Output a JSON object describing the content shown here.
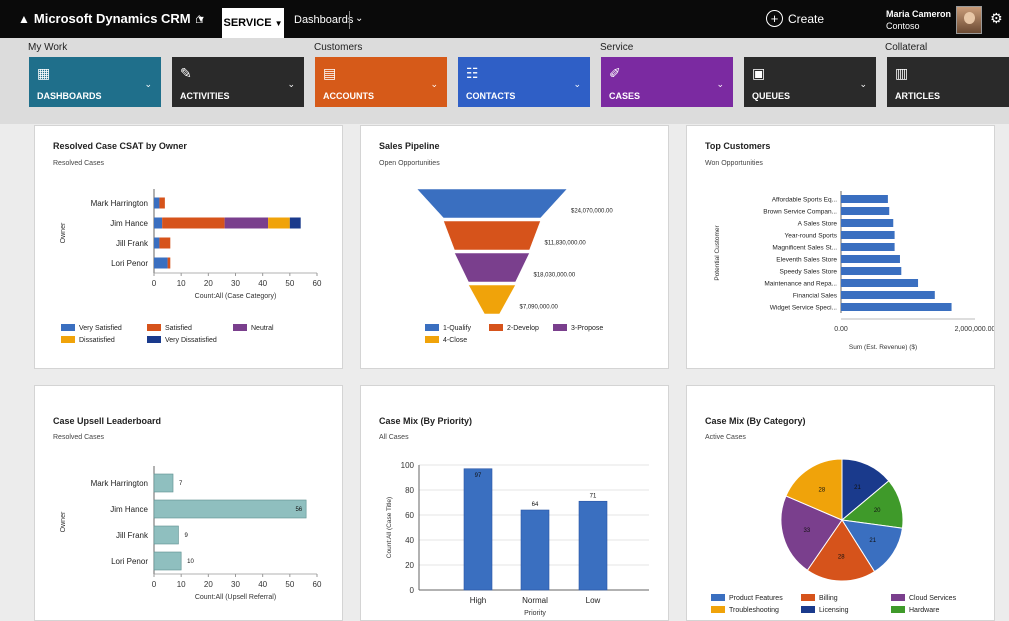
{
  "topbar": {
    "brand": "Microsoft Dynamics CRM",
    "area": "SERVICE",
    "nav": "Dashboards",
    "create": "Create",
    "user_name": "Maria Cameron",
    "user_org": "Contoso"
  },
  "nav_groups": [
    "My Work",
    "Customers",
    "Service",
    "Collateral"
  ],
  "tiles": [
    {
      "label": "DASHBOARDS",
      "icon": "dashboard-icon",
      "color": "#1f6f8b"
    },
    {
      "label": "ACTIVITIES",
      "icon": "activities-icon",
      "color": "#2a2a2a"
    },
    {
      "label": "ACCOUNTS",
      "icon": "accounts-icon",
      "color": "#d65a19"
    },
    {
      "label": "CONTACTS",
      "icon": "contacts-icon",
      "color": "#2f5fc6"
    },
    {
      "label": "CASES",
      "icon": "cases-icon",
      "color": "#7b2aa1"
    },
    {
      "label": "QUEUES",
      "icon": "queues-icon",
      "color": "#2a2a2a"
    },
    {
      "label": "ARTICLES",
      "icon": "articles-icon",
      "color": "#2a2a2a"
    }
  ],
  "cards": {
    "csat": {
      "title": "Resolved Case CSAT by Owner",
      "subtitle": "Resolved Cases"
    },
    "pipeline": {
      "title": "Sales Pipeline",
      "subtitle": "Open Opportunities"
    },
    "customers": {
      "title": "Top Customers",
      "subtitle": "Won Opportunities"
    },
    "upsell": {
      "title": "Case Upsell Leaderboard",
      "subtitle": "Resolved Cases"
    },
    "priority": {
      "title": "Case Mix (By Priority)",
      "subtitle": "All Cases"
    },
    "category": {
      "title": "Case Mix (By Category)",
      "subtitle": "Active Cases"
    }
  },
  "chart_data": [
    {
      "id": "csat",
      "type": "bar",
      "orientation": "horizontal",
      "stacked": true,
      "categories": [
        "Mark Harrington",
        "Jim Hance",
        "Jill Frank",
        "Lori Penor"
      ],
      "series": [
        {
          "name": "Very Satisfied",
          "color": "#3a6fc0",
          "values": [
            2,
            3,
            2,
            5
          ]
        },
        {
          "name": "Satisfied",
          "color": "#d6531b",
          "values": [
            2,
            23,
            4,
            1
          ]
        },
        {
          "name": "Neutral",
          "color": "#7a3f8d",
          "values": [
            0,
            16,
            0,
            0
          ]
        },
        {
          "name": "Dissatisfied",
          "color": "#f0a30a",
          "values": [
            0,
            8,
            0,
            0
          ]
        },
        {
          "name": "Very Dissatisfied",
          "color": "#1a3a8c",
          "values": [
            0,
            4,
            0,
            0
          ]
        }
      ],
      "xlabel": "Count:All (Case Category)",
      "ylabel": "Owner",
      "xlim": [
        0,
        60
      ],
      "xticks": [
        "0",
        "10",
        "20",
        "30",
        "40",
        "50",
        "60"
      ],
      "legend": "bottom"
    },
    {
      "id": "pipeline",
      "type": "funnel",
      "categories": [
        "1-Qualify",
        "2-Develop",
        "3-Propose",
        "4-Close"
      ],
      "values": [
        24070000,
        11830000,
        18030000,
        7090000
      ],
      "labels": [
        "$24,070,000.00",
        "$11,830,000.00",
        "$18,030,000.00",
        "$7,090,000.00"
      ],
      "colors": [
        "#3a6fc0",
        "#d6531b",
        "#7a3f8d",
        "#f0a30a"
      ],
      "legend": "bottom"
    },
    {
      "id": "customers",
      "type": "bar",
      "orientation": "horizontal",
      "categories": [
        "Affordable Sports Eq...",
        "Brown Service Compan...",
        "A Sales Store",
        "Year-round Sports",
        "Magnificent Sales St...",
        "Eleventh Sales Store",
        "Speedy Sales Store",
        "Maintenance and Repa...",
        "Financial Sales",
        "Widget Service Speci..."
      ],
      "values": [
        700000,
        720000,
        780000,
        800000,
        800000,
        880000,
        900000,
        1150000,
        1400000,
        1650000
      ],
      "xlabel": "Sum (Est. Revenue) ($)",
      "ylabel": "Potential Customer",
      "xlim": [
        0,
        2000000
      ],
      "xticks": [
        "0.00",
        "2,000,000.00"
      ],
      "color": "#3a6fc0"
    },
    {
      "id": "upsell",
      "type": "bar",
      "orientation": "horizontal",
      "categories": [
        "Mark Harrington",
        "Jim Hance",
        "Jill Frank",
        "Lori Penor"
      ],
      "values": [
        7,
        56,
        9,
        10
      ],
      "xlabel": "Count:All (Upsell Referral)",
      "ylabel": "Owner",
      "xlim": [
        0,
        60
      ],
      "xticks": [
        "0",
        "10",
        "20",
        "30",
        "40",
        "50",
        "60"
      ],
      "color": "#8fbfbf"
    },
    {
      "id": "priority",
      "type": "bar",
      "orientation": "vertical",
      "categories": [
        "High",
        "Normal",
        "Low"
      ],
      "values": [
        97,
        64,
        71
      ],
      "xlabel": "Priority",
      "ylabel": "Count:All (Case Title)",
      "ylim": [
        0,
        100
      ],
      "yticks": [
        "0",
        "20",
        "40",
        "60",
        "80",
        "100"
      ],
      "color": "#3a6fc0"
    },
    {
      "id": "category",
      "type": "pie",
      "categories": [
        "Product Features",
        "Billing",
        "Cloud Services",
        "Troubleshooting",
        "Licensing",
        "Hardware"
      ],
      "slices": [
        {
          "name": "Licensing",
          "value": 21,
          "color": "#1a3a8c"
        },
        {
          "name": "Hardware",
          "value": 20,
          "color": "#3f9a2a"
        },
        {
          "name": "Product Features",
          "value": 21,
          "color": "#3a6fc0"
        },
        {
          "name": "Billing",
          "value": 28,
          "color": "#d6531b"
        },
        {
          "name": "Cloud Services",
          "value": 33,
          "color": "#7a3f8d"
        },
        {
          "name": "Troubleshooting",
          "value": 28,
          "color": "#f0a30a"
        }
      ],
      "legend": "bottom"
    }
  ]
}
